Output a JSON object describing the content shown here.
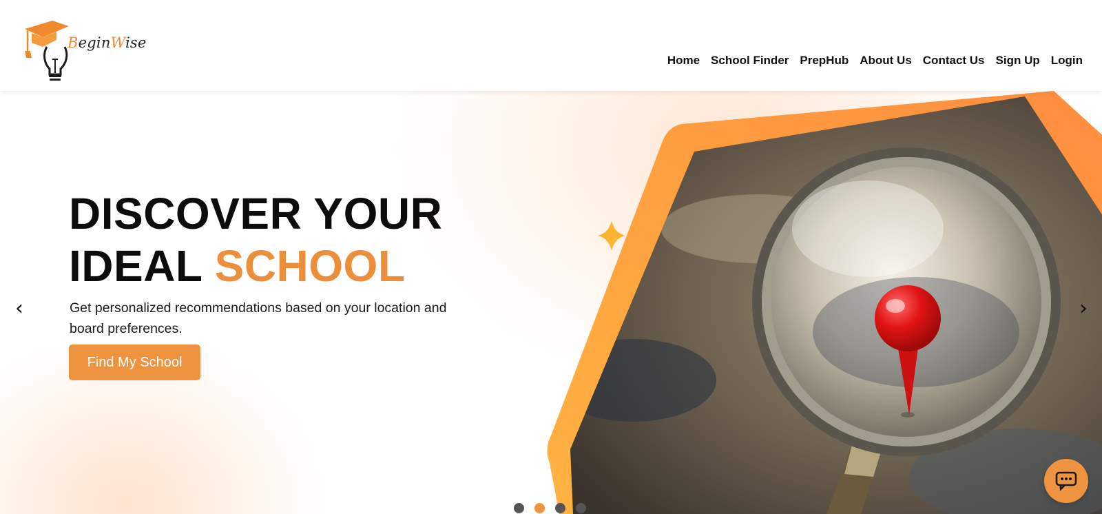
{
  "header": {
    "logo_text_a": "B",
    "logo_text_b": "egin",
    "logo_text_c": "W",
    "logo_text_d": "ise",
    "nav": [
      "Home",
      "School Finder",
      "PrepHub",
      "About Us",
      "Contact Us",
      "Sign Up",
      "Login"
    ]
  },
  "hero": {
    "headline_line1": "DISCOVER YOUR",
    "headline_line2_a": "IDEAL ",
    "headline_line2_b": "SCHOOL",
    "subtitle": "Get personalized recommendations based on your location and board preferences.",
    "cta": "Find My School",
    "prev_arrow": "‹",
    "next_arrow": "›",
    "slides_count": 4,
    "active_slide": 2
  },
  "colors": {
    "accent": "#ee9440",
    "headline_accent": "#ec8f3c",
    "text": "#0c0c0c"
  },
  "icons": {
    "logo": "graduation-cap-lightbulb-icon",
    "chat": "chat-bubble-icon",
    "sparkle": "sparkle-icon",
    "map_pin": "map-pin-icon",
    "magnifier": "magnifying-glass-icon"
  }
}
